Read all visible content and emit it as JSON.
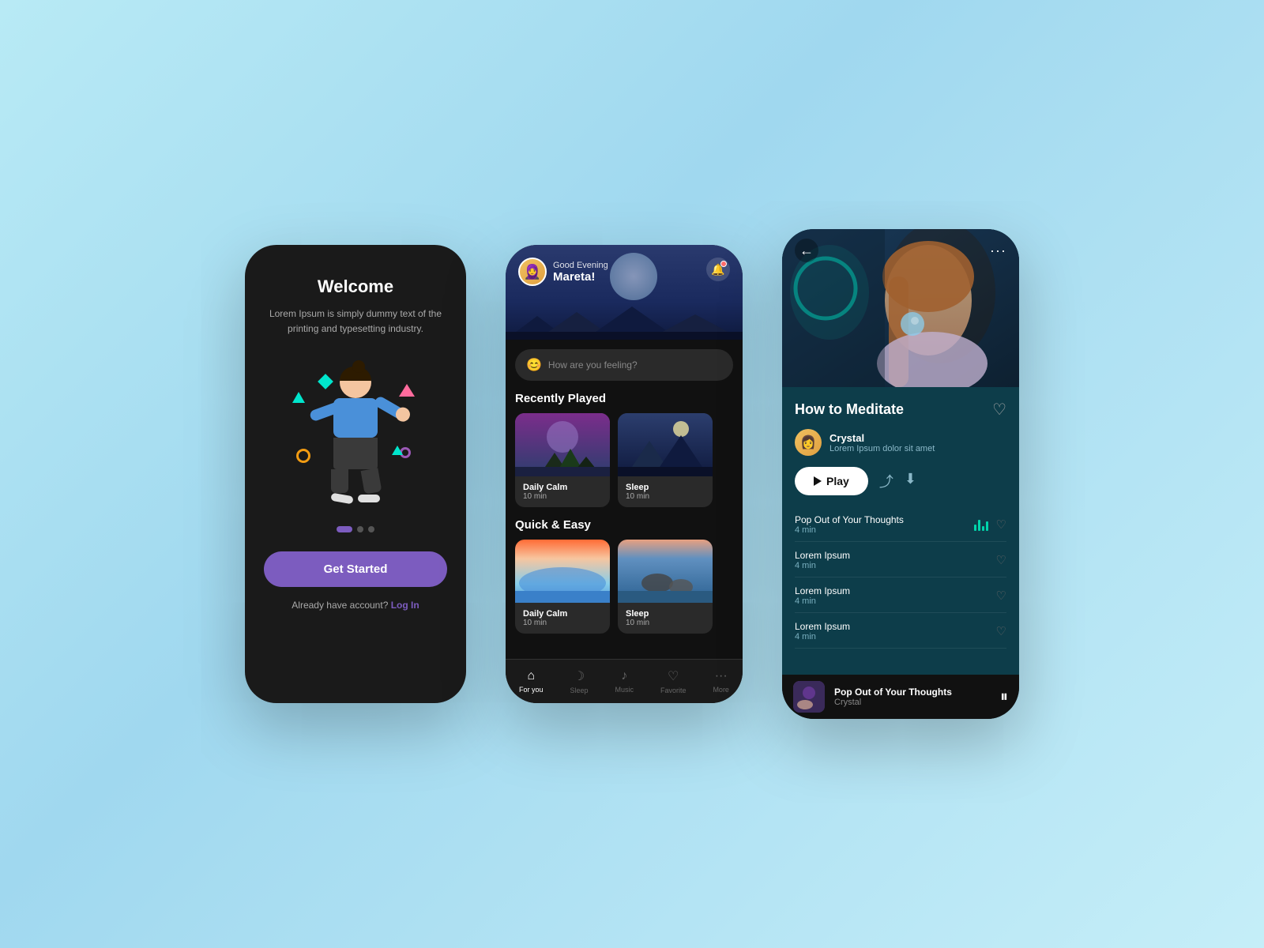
{
  "background": {
    "color_start": "#b8eaf5",
    "color_end": "#a0d8ef"
  },
  "phone1": {
    "title": "Welcome",
    "subtitle": "Lorem Ipsum is simply dummy text of the printing and typesetting industry.",
    "dots": [
      {
        "active": true
      },
      {
        "active": false
      },
      {
        "active": false
      }
    ],
    "cta_label": "Get Started",
    "login_text": "Already have account?",
    "login_link": "Log In"
  },
  "phone2": {
    "header": {
      "greeting_top": "Good Evening",
      "greeting_name": "Mareta!",
      "avatar_emoji": "🧕"
    },
    "search": {
      "placeholder": "How are you feeling?",
      "emoji": "😊"
    },
    "recently_played": {
      "section_label": "Recently Played",
      "cards": [
        {
          "title": "Daily Calm",
          "duration": "10 min",
          "type": "purple"
        },
        {
          "title": "Sleep",
          "duration": "10 min",
          "type": "dark"
        },
        {
          "title": "...",
          "duration": "...",
          "type": "hidden"
        }
      ]
    },
    "quick_easy": {
      "section_label": "Quick & Easy",
      "cards": [
        {
          "title": "Daily Calm",
          "duration": "10 min",
          "type": "sunset"
        },
        {
          "title": "Sleep",
          "duration": "10 min",
          "type": "ocean"
        },
        {
          "title": "...",
          "duration": "...",
          "type": "hidden"
        }
      ]
    },
    "nav": {
      "items": [
        {
          "icon": "🏠",
          "label": "For you",
          "active": true
        },
        {
          "icon": "🌙",
          "label": "Sleep",
          "active": false
        },
        {
          "icon": "🎵",
          "label": "Music",
          "active": false
        },
        {
          "icon": "♡",
          "label": "Favorite",
          "active": false
        },
        {
          "icon": "···",
          "label": "More",
          "active": false
        }
      ]
    }
  },
  "phone3": {
    "topbar": {
      "back_label": "←",
      "more_label": "···"
    },
    "meditation": {
      "title": "How to Meditate",
      "artist_name": "Crystal",
      "artist_desc": "Lorem Ipsum dolor sit amet",
      "play_label": "Play"
    },
    "tracks": [
      {
        "name": "Pop Out of Your Thoughts",
        "duration": "4 min",
        "active": true
      },
      {
        "name": "Lorem Ipsum",
        "duration": "4 min",
        "active": false
      },
      {
        "name": "Lorem Ipsum",
        "duration": "4 min",
        "active": false
      },
      {
        "name": "Lorem Ipsum",
        "duration": "4 min",
        "active": false
      }
    ],
    "player": {
      "title": "Pop Out of Your Thoughts",
      "artist": "Crystal"
    }
  }
}
